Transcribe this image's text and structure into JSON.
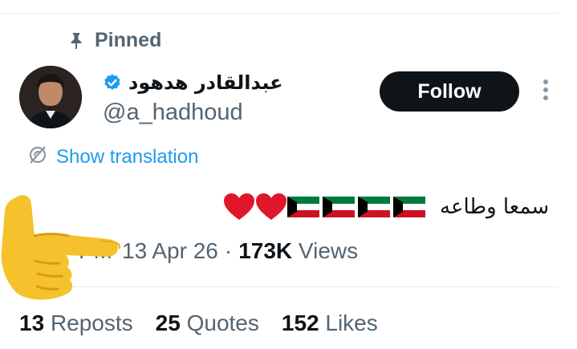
{
  "pinned": {
    "label": "Pinned",
    "icon": "pin-icon"
  },
  "author": {
    "name": "عبدالقادر هدهود",
    "handle": "@a_hadhoud",
    "verified_color": "#1d9bf0"
  },
  "follow": {
    "label": "Follow"
  },
  "translate": {
    "label": "Show translation",
    "icon": "translate-icon"
  },
  "tweet": {
    "text": "سمعا وطاعه",
    "emojis": [
      "kuwait-flag-emoji",
      "kuwait-flag-emoji",
      "kuwait-flag-emoji",
      "kuwait-flag-emoji",
      "red-heart-emoji",
      "red-heart-emoji"
    ]
  },
  "meta": {
    "time_fragment": "PM",
    "date": "13 Apr 26",
    "separator": "·",
    "views_count": "173K",
    "views_label": "Views"
  },
  "stats": {
    "reposts_count": "13",
    "reposts_label": "Reposts",
    "quotes_count": "25",
    "quotes_label": "Quotes",
    "likes_count": "152",
    "likes_label": "Likes"
  },
  "colors": {
    "accent": "#1d9bf0",
    "secondary_text": "#536471",
    "primary_text": "#0f1419"
  },
  "overlay": {
    "icon": "backhand-index-pointing-right-emoji"
  }
}
